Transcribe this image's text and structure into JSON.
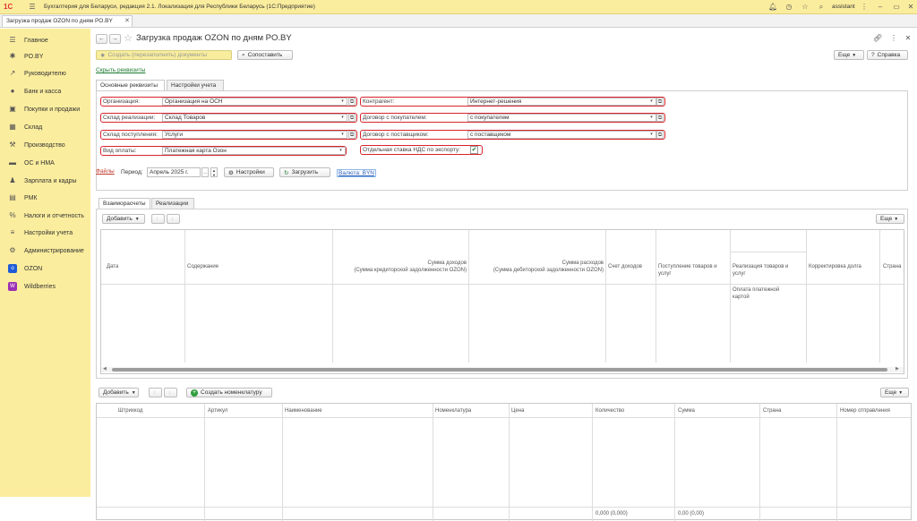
{
  "titlebar": {
    "logo": "1С",
    "title": "Бухгалтерия для Беларуси, редакция 2.1. Локализация для Республики Беларусь  (1С:Предприятие)",
    "user": "assistant"
  },
  "tabbar": {
    "tab_label": "Загрузка продаж OZON по дням PO.BY"
  },
  "sidebar": {
    "items": [
      {
        "label": "Главное",
        "icon": "menu-icon"
      },
      {
        "label": "PO.BY",
        "icon": "star-icon"
      },
      {
        "label": "Руководителю",
        "icon": "chart-line-icon"
      },
      {
        "label": "Банк и касса",
        "icon": "coins-icon"
      },
      {
        "label": "Покупки и продажи",
        "icon": "cart-icon"
      },
      {
        "label": "Склад",
        "icon": "warehouse-icon"
      },
      {
        "label": "Производство",
        "icon": "factory-icon"
      },
      {
        "label": "ОС и НМА",
        "icon": "building-icon"
      },
      {
        "label": "Зарплата и кадры",
        "icon": "person-icon"
      },
      {
        "label": "РМК",
        "icon": "cashier-icon"
      },
      {
        "label": "Налоги и отчетность",
        "icon": "tax-icon"
      },
      {
        "label": "Настройки учета",
        "icon": "settings-icon"
      },
      {
        "label": "Администрирование",
        "icon": "gear-icon"
      },
      {
        "label": "OZON",
        "icon": "ozon-icon"
      },
      {
        "label": "Wildberries",
        "icon": "wildberries-icon"
      }
    ]
  },
  "form": {
    "title": "Загрузка продаж OZON по дням PO.BY",
    "create_button": "Создать (перезаполнить) документы",
    "compare_button": "Сопоставить",
    "more_button": "Еще",
    "help_button": "Справка",
    "hide_details_link": "Скрыть реквизиты",
    "tabs": [
      "Основные реквизиты",
      "Настройки учета"
    ],
    "left_fields": [
      {
        "label": "Организация:",
        "value": "Организация на ОСН"
      },
      {
        "label": "Склад реализации:",
        "value": "Склад Товаров"
      },
      {
        "label": "Склад поступления:",
        "value": "Услуги"
      },
      {
        "label": "Вид оплаты:",
        "value": "Платежная карта Озон"
      }
    ],
    "right_fields": [
      {
        "label": "Контрагент:",
        "value": "Интернет-решения"
      },
      {
        "label": "Договор с покупателем:",
        "value": "с покупателем"
      },
      {
        "label": "Договор с поставщиком:",
        "value": "с поставщиком"
      }
    ],
    "vat_label": "Отдельная ставка НДС по экспорту:",
    "vat_checked": true,
    "files_link": "Файлы",
    "period_label": "Период:",
    "period_value": "Апрель 2025 г.",
    "settings_button": "Настройки",
    "load_button": "Загрузить",
    "currency_link": "Валюта: BYN"
  },
  "table1": {
    "tabs": [
      "Взаиморасчеты",
      "Реализации"
    ],
    "add_button": "Добавить",
    "more_button": "Еще",
    "columns": [
      "Дата",
      "Содержание",
      "Сумма доходов",
      "(Сумма кредиторской задолженности OZON)",
      "Сумма расходов",
      "(Сумма дебиторской задолженности OZON)",
      "Счет доходов",
      "Поступление товаров и",
      "услуг",
      "Реализация товаров и",
      "услуг",
      "Оплата платежной",
      "картой",
      "Корректировка долга",
      "Страна"
    ]
  },
  "table2": {
    "add_button": "Добавить",
    "create_nomenclature_button": "Создать номенклатуру",
    "more_button": "Еще",
    "columns": [
      "Штрихкод",
      "Артикул",
      "Наименование",
      "Номенклатура",
      "Цена",
      "Количество",
      "Сумма",
      "Страна",
      "Номер отправления"
    ],
    "totals": {
      "quantity": "0,000 (0,000)",
      "sum": "0,00 (0,00)"
    }
  }
}
